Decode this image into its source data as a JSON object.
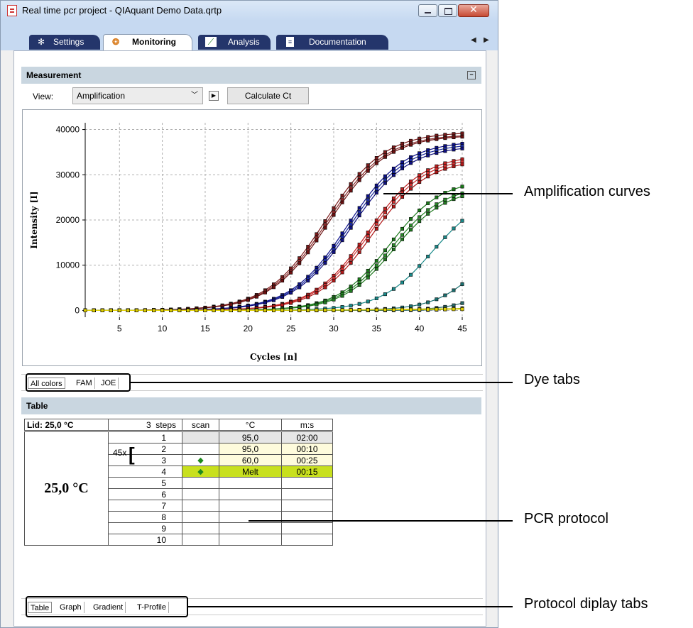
{
  "window": {
    "title": "Real time pcr project - QIAquant Demo Data.qrtp",
    "tabs": [
      {
        "label": "Settings",
        "icon": "gear-icon"
      },
      {
        "label": "Monitoring",
        "icon": "monitoring-icon"
      },
      {
        "label": "Analysis",
        "icon": "chart-icon"
      },
      {
        "label": "Documentation",
        "icon": "document-icon"
      }
    ],
    "active_tab": "Monitoring"
  },
  "measurement": {
    "header": "Measurement",
    "view_label": "View:",
    "view_value": "Amplification",
    "calc_button": "Calculate Ct"
  },
  "chart_data": {
    "type": "line",
    "xlabel": "Cycles [n]",
    "ylabel": "Intensity [I]",
    "xlim": [
      1,
      45
    ],
    "ylim": [
      -1500,
      41500
    ],
    "x_ticks": [
      5,
      10,
      15,
      20,
      25,
      30,
      35,
      40,
      45
    ],
    "y_ticks": [
      0,
      10000,
      20000,
      30000,
      40000
    ],
    "grid": true,
    "series": [
      {
        "color": "#7a1a1a",
        "plateau": 39500,
        "midpoint": 29.0,
        "slope": 3.4
      },
      {
        "color": "#8b2a2a",
        "plateau": 39000,
        "midpoint": 29.2,
        "slope": 3.4
      },
      {
        "color": "#6b1010",
        "plateau": 38800,
        "midpoint": 29.4,
        "slope": 3.4
      },
      {
        "color": "#0b0f8a",
        "plateau": 37500,
        "midpoint": 31.6,
        "slope": 3.3
      },
      {
        "color": "#1a2aa0",
        "plateau": 37000,
        "midpoint": 31.8,
        "slope": 3.3
      },
      {
        "color": "#101080",
        "plateau": 36500,
        "midpoint": 32.0,
        "slope": 3.3
      },
      {
        "color": "#c02020",
        "plateau": 34500,
        "midpoint": 34.0,
        "slope": 3.2
      },
      {
        "color": "#d03030",
        "plateau": 34000,
        "midpoint": 34.2,
        "slope": 3.2
      },
      {
        "color": "#b01818",
        "plateau": 33500,
        "midpoint": 34.5,
        "slope": 3.2
      },
      {
        "color": "#1a7a1a",
        "plateau": 29000,
        "midpoint": 36.5,
        "slope": 3.0
      },
      {
        "color": "#2a8a2a",
        "plateau": 27500,
        "midpoint": 36.7,
        "slope": 3.0
      },
      {
        "color": "#207a20",
        "plateau": 27000,
        "midpoint": 37.0,
        "slope": 3.0
      },
      {
        "color": "#1a8a8a",
        "plateau": 26000,
        "midpoint": 41.5,
        "slope": 3.0
      },
      {
        "color": "#1a7070",
        "plateau": 20000,
        "midpoint": 47.5,
        "slope": 2.8
      },
      {
        "color": "#2a6a6a",
        "plateau": 15000,
        "midpoint": 50.5,
        "slope": 2.6
      },
      {
        "color": "#1a5a5a",
        "plateau": 10000,
        "midpoint": 52.5,
        "slope": 2.5
      },
      {
        "color": "#c8c800",
        "plateau": 600,
        "midpoint": 40.0,
        "slope": 6.0
      },
      {
        "color": "#e0d000",
        "plateau": 400,
        "midpoint": 40.0,
        "slope": 6.0
      }
    ]
  },
  "dye_tabs": [
    "All colors",
    "FAM",
    "JOE"
  ],
  "table_section": {
    "header": "Table",
    "lid": "Lid: 25,0 °C",
    "temperature": "25,0 °C",
    "steps_header": "3  steps",
    "scan_header": "scan",
    "temp_header": "°C",
    "time_header": "m:s",
    "loop_label": "45x",
    "rows": [
      {
        "step": "1",
        "scan": "",
        "temp": "95,0",
        "time": "02:00"
      },
      {
        "step": "2",
        "scan": "",
        "temp": "95,0",
        "time": "00:10"
      },
      {
        "step": "3",
        "scan": "◆",
        "temp": "60,0",
        "time": "00:25"
      },
      {
        "step": "4",
        "scan": "◆",
        "temp": "Melt",
        "time": "00:15"
      },
      {
        "step": "5",
        "scan": "",
        "temp": "",
        "time": ""
      },
      {
        "step": "6",
        "scan": "",
        "temp": "",
        "time": ""
      },
      {
        "step": "7",
        "scan": "",
        "temp": "",
        "time": ""
      },
      {
        "step": "8",
        "scan": "",
        "temp": "",
        "time": ""
      },
      {
        "step": "9",
        "scan": "",
        "temp": "",
        "time": ""
      },
      {
        "step": "10",
        "scan": "",
        "temp": "",
        "time": ""
      }
    ]
  },
  "protocol_tabs": [
    "Table",
    "Graph",
    "Gradient",
    "T-Profile"
  ],
  "annotations": {
    "amplification": "Amplification curves",
    "dye_tabs": "Dye tabs",
    "pcr_protocol": "PCR protocol",
    "protocol_tabs": "Protocol diplay tabs"
  },
  "colors": {
    "title_bar": "#c6d9f1",
    "tab_dark": "#24356b",
    "section_header": "#c9d6e0",
    "row_light_yellow": "#fefbdc",
    "row_melt": "#c8e01e",
    "scan_marker": "#1e8a1e",
    "row_grey": "#e6e6e6"
  }
}
